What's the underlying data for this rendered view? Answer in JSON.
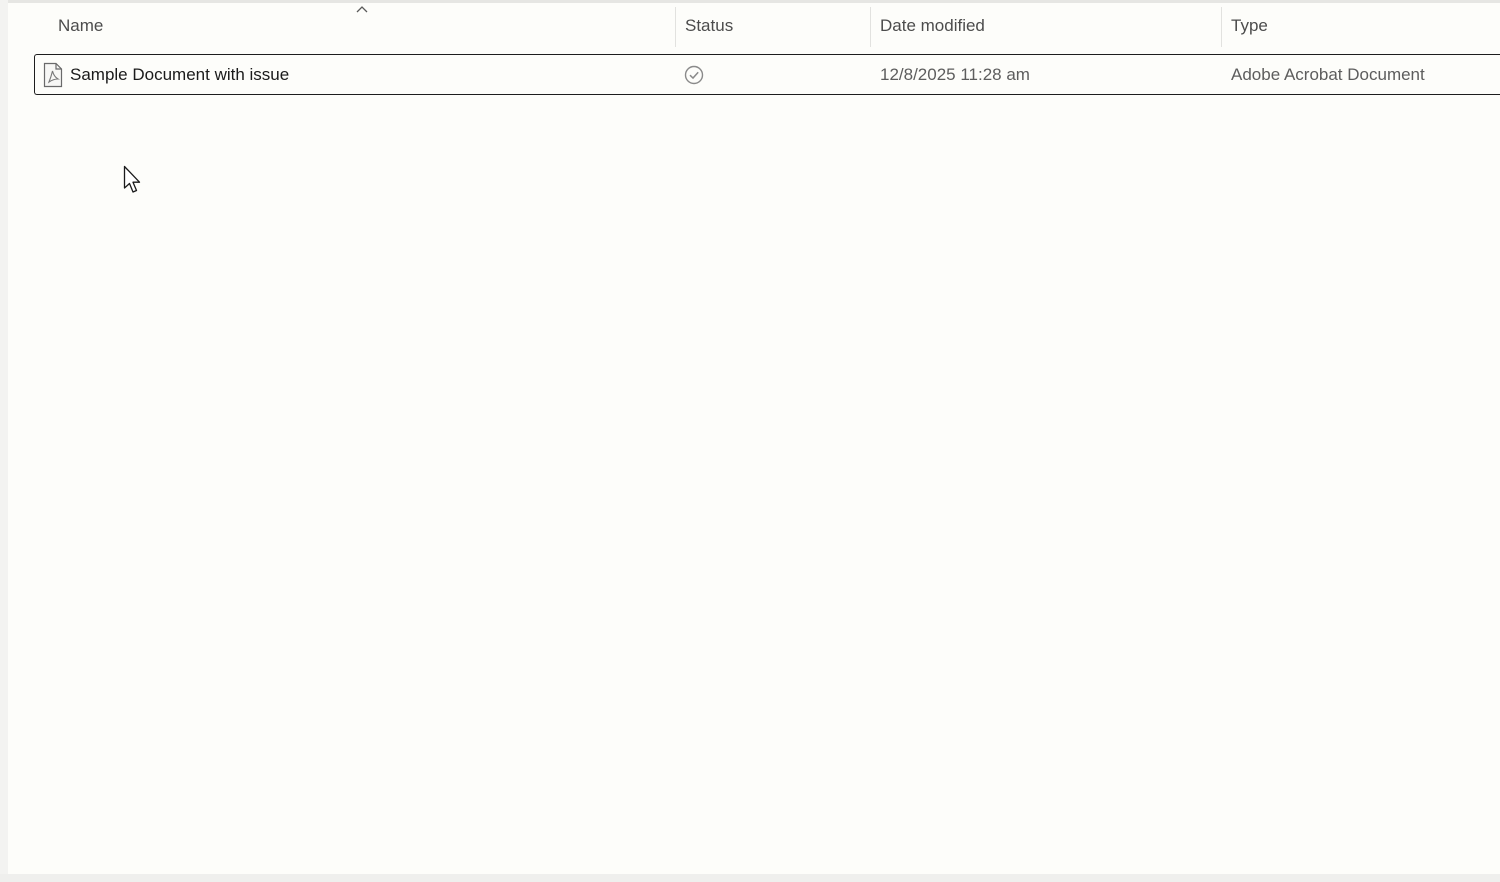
{
  "columns": {
    "name": "Name",
    "status": "Status",
    "date_modified": "Date modified",
    "type": "Type"
  },
  "sort": {
    "column": "name",
    "direction": "ascending",
    "icon": "chevron-up-icon"
  },
  "files": [
    {
      "name": "Sample Document with issue",
      "icon": "pdf-file-icon",
      "status_icon": "sync-complete-check-icon",
      "date_modified": "12/8/2025 11:28 am",
      "type": "Adobe Acrobat Document",
      "selected": true
    }
  ],
  "colors": {
    "background": "#fdfdfa",
    "header_text": "#4c4c4c",
    "primary_text": "#1b1b1b",
    "secondary_text": "#5d5d5d",
    "selection_border": "#1d1d1d",
    "status_icon": "#8a8a8a"
  },
  "cursor_icon": "mouse-pointer-icon"
}
